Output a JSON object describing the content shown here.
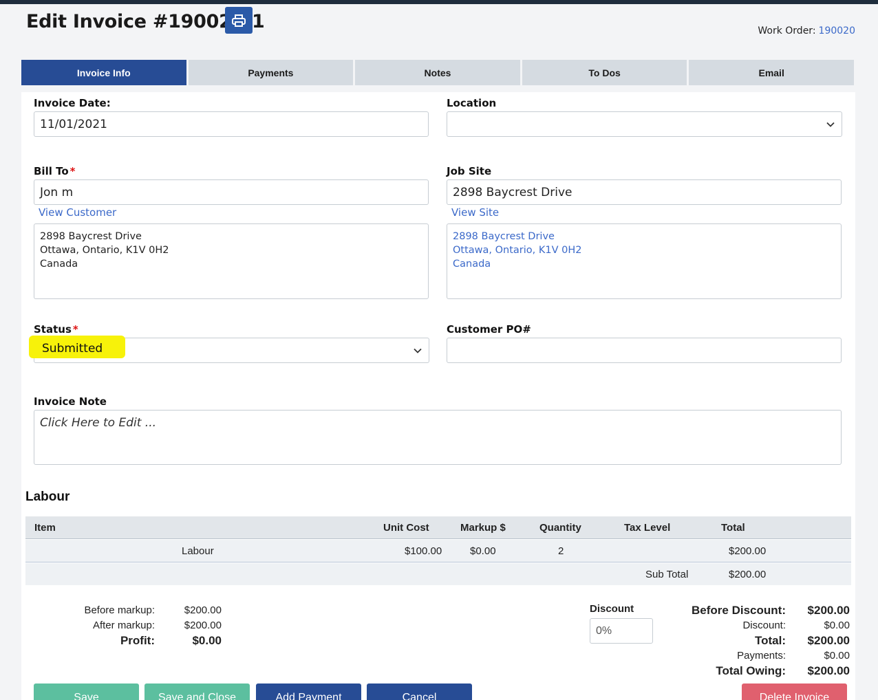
{
  "header": {
    "title": "Edit Invoice #190020-1",
    "work_order_label": "Work Order:",
    "work_order_value": "190020"
  },
  "tabs": [
    {
      "label": "Invoice Info",
      "active": true
    },
    {
      "label": "Payments",
      "active": false
    },
    {
      "label": "Notes",
      "active": false
    },
    {
      "label": "To Dos",
      "active": false
    },
    {
      "label": "Email",
      "active": false
    }
  ],
  "form": {
    "invoice_date_label": "Invoice Date:",
    "invoice_date_value": "11/01/2021",
    "location_label": "Location",
    "location_value": "",
    "bill_to_label": "Bill To",
    "bill_to_value": "Jon m",
    "view_customer": "View Customer",
    "bill_address": [
      "2898 Baycrest Drive",
      "Ottawa, Ontario, K1V 0H2",
      "Canada"
    ],
    "job_site_label": "Job Site",
    "job_site_value": "2898 Baycrest Drive",
    "view_site": "View Site",
    "site_address": [
      "2898 Baycrest Drive",
      "Ottawa, Ontario, K1V 0H2",
      "Canada"
    ],
    "required_mark": "*",
    "status_label": "Status",
    "status_value": "Submitted",
    "customer_po_label": "Customer PO#",
    "customer_po_value": "",
    "invoice_note_label": "Invoice Note",
    "invoice_note_placeholder": "Click Here to Edit ..."
  },
  "labour": {
    "title": "Labour",
    "columns": [
      "Item",
      "Unit Cost",
      "Markup $",
      "Quantity",
      "Tax Level",
      "Total"
    ],
    "rows": [
      {
        "item": "Labour",
        "unit_cost": "$100.00",
        "markup": "$0.00",
        "quantity": "2",
        "tax_level": "",
        "total": "$200.00"
      }
    ],
    "subtotal_label": "Sub Total",
    "subtotal_value": "$200.00"
  },
  "markup_summary": {
    "before_markup_label": "Before markup:",
    "before_markup_value": "$200.00",
    "after_markup_label": "After markup:",
    "after_markup_value": "$200.00",
    "profit_label": "Profit:",
    "profit_value": "$0.00"
  },
  "discount": {
    "label": "Discount",
    "placeholder": "0%"
  },
  "totals": {
    "before_discount_label": "Before Discount:",
    "before_discount_value": "$200.00",
    "discount_label": "Discount:",
    "discount_value": "$0.00",
    "total_label": "Total:",
    "total_value": "$200.00",
    "payments_label": "Payments:",
    "payments_value": "$0.00",
    "total_owing_label": "Total Owing:",
    "total_owing_value": "$200.00"
  },
  "buttons": {
    "save": "Save",
    "save_close": "Save and Close",
    "add_payment": "Add Payment",
    "cancel": "Cancel",
    "delete": "Delete Invoice"
  },
  "colors": {
    "primary": "#274c95",
    "success": "#5cbf9f",
    "danger": "#e0606e",
    "link": "#3b69c9",
    "highlight": "#f7f20a"
  },
  "icons": {
    "print": "printer-icon",
    "select_arrow": "chevron-down-icon"
  }
}
